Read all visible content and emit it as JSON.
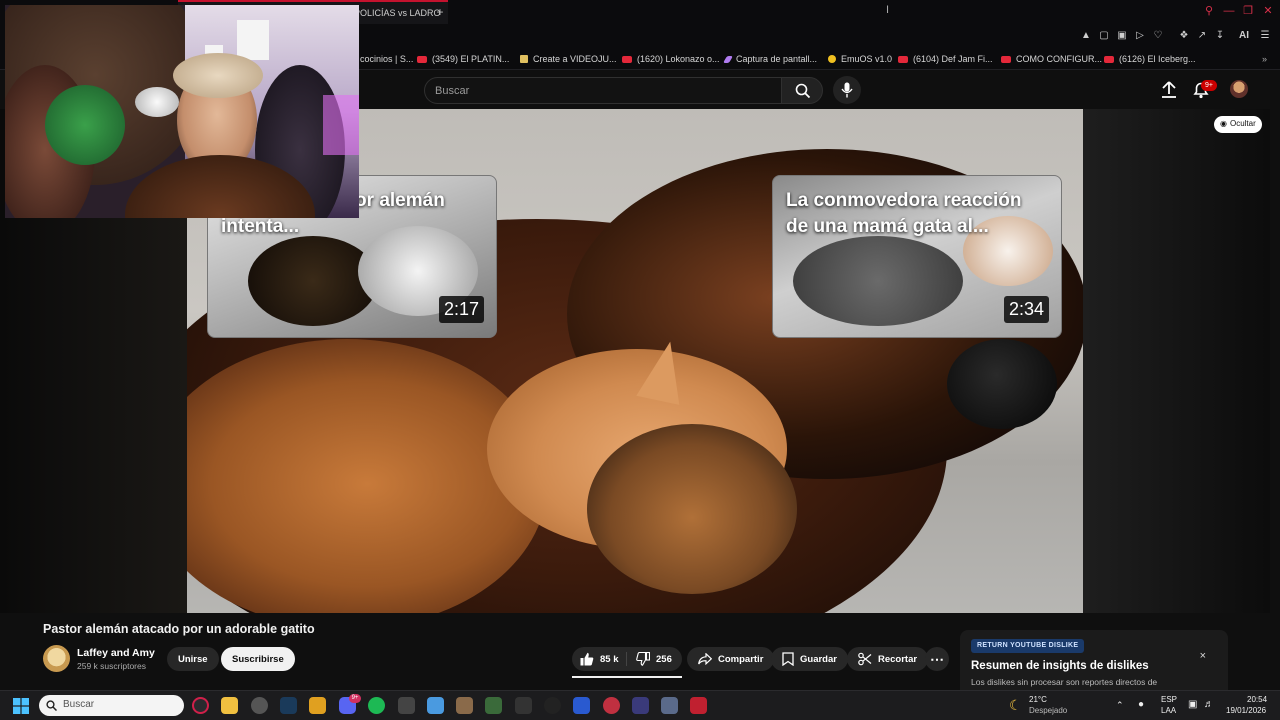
{
  "browser": {
    "active_tab_title": "POLICÍAS vs LADRO",
    "bookmarks": [
      {
        "label": "cocinios | S...",
        "icon": "youtube-icon"
      },
      {
        "label": "(3549) El PLATIN...",
        "icon": "youtube-icon"
      },
      {
        "label": "Create a VIDEOJU...",
        "icon": "doc-icon"
      },
      {
        "label": "(1620) Lokonazo o...",
        "icon": "youtube-icon"
      },
      {
        "label": "Captura de pantall...",
        "icon": "feather-icon"
      },
      {
        "label": "EmuOS v1.0",
        "icon": "emu-icon"
      },
      {
        "label": "(6104) Def Jam Fi...",
        "icon": "youtube-icon"
      },
      {
        "label": "COMO CONFIGUR...",
        "icon": "youtube-icon"
      },
      {
        "label": "(6126) El Iceberg...",
        "icon": "youtube-icon"
      }
    ],
    "ai_label": "AI"
  },
  "youtube": {
    "search_placeholder": "Buscar",
    "notifications_badge": "9+",
    "hide_label": "Ocultar"
  },
  "endcards": [
    {
      "title": "...ando un pastor alemán intenta...",
      "duration": "2:17"
    },
    {
      "title": "La conmovedora reacción de una mamá gata al...",
      "duration": "2:34"
    }
  ],
  "video": {
    "title": "Pastor alemán atacado por un adorable gatito",
    "channel_name": "Laffey and Amy",
    "subscribers": "259 k suscriptores",
    "join_label": "Unirse",
    "subscribe_label": "Suscribirse",
    "likes": "85 k",
    "dislikes": "256",
    "share_label": "Compartir",
    "save_label": "Guardar",
    "clip_label": "Recortar"
  },
  "dislike_popup": {
    "badge": "RETURN YOUTUBE DISLIKE",
    "heading": "Resumen de insights de dislikes",
    "body": "Los dislikes sin procesar son reportes directos de",
    "close": "×"
  },
  "taskbar": {
    "search_placeholder": "Buscar",
    "weather_temp": "21°C",
    "weather_desc": "Despejado",
    "lang_line1": "ESP",
    "lang_line2": "LAA",
    "time": "20:54",
    "date": "19/01/2026",
    "discord_badge": "9+"
  },
  "colors": {
    "accent_red": "#cc0000",
    "page_bg": "#0f0f0f",
    "button_bg": "#272727"
  }
}
